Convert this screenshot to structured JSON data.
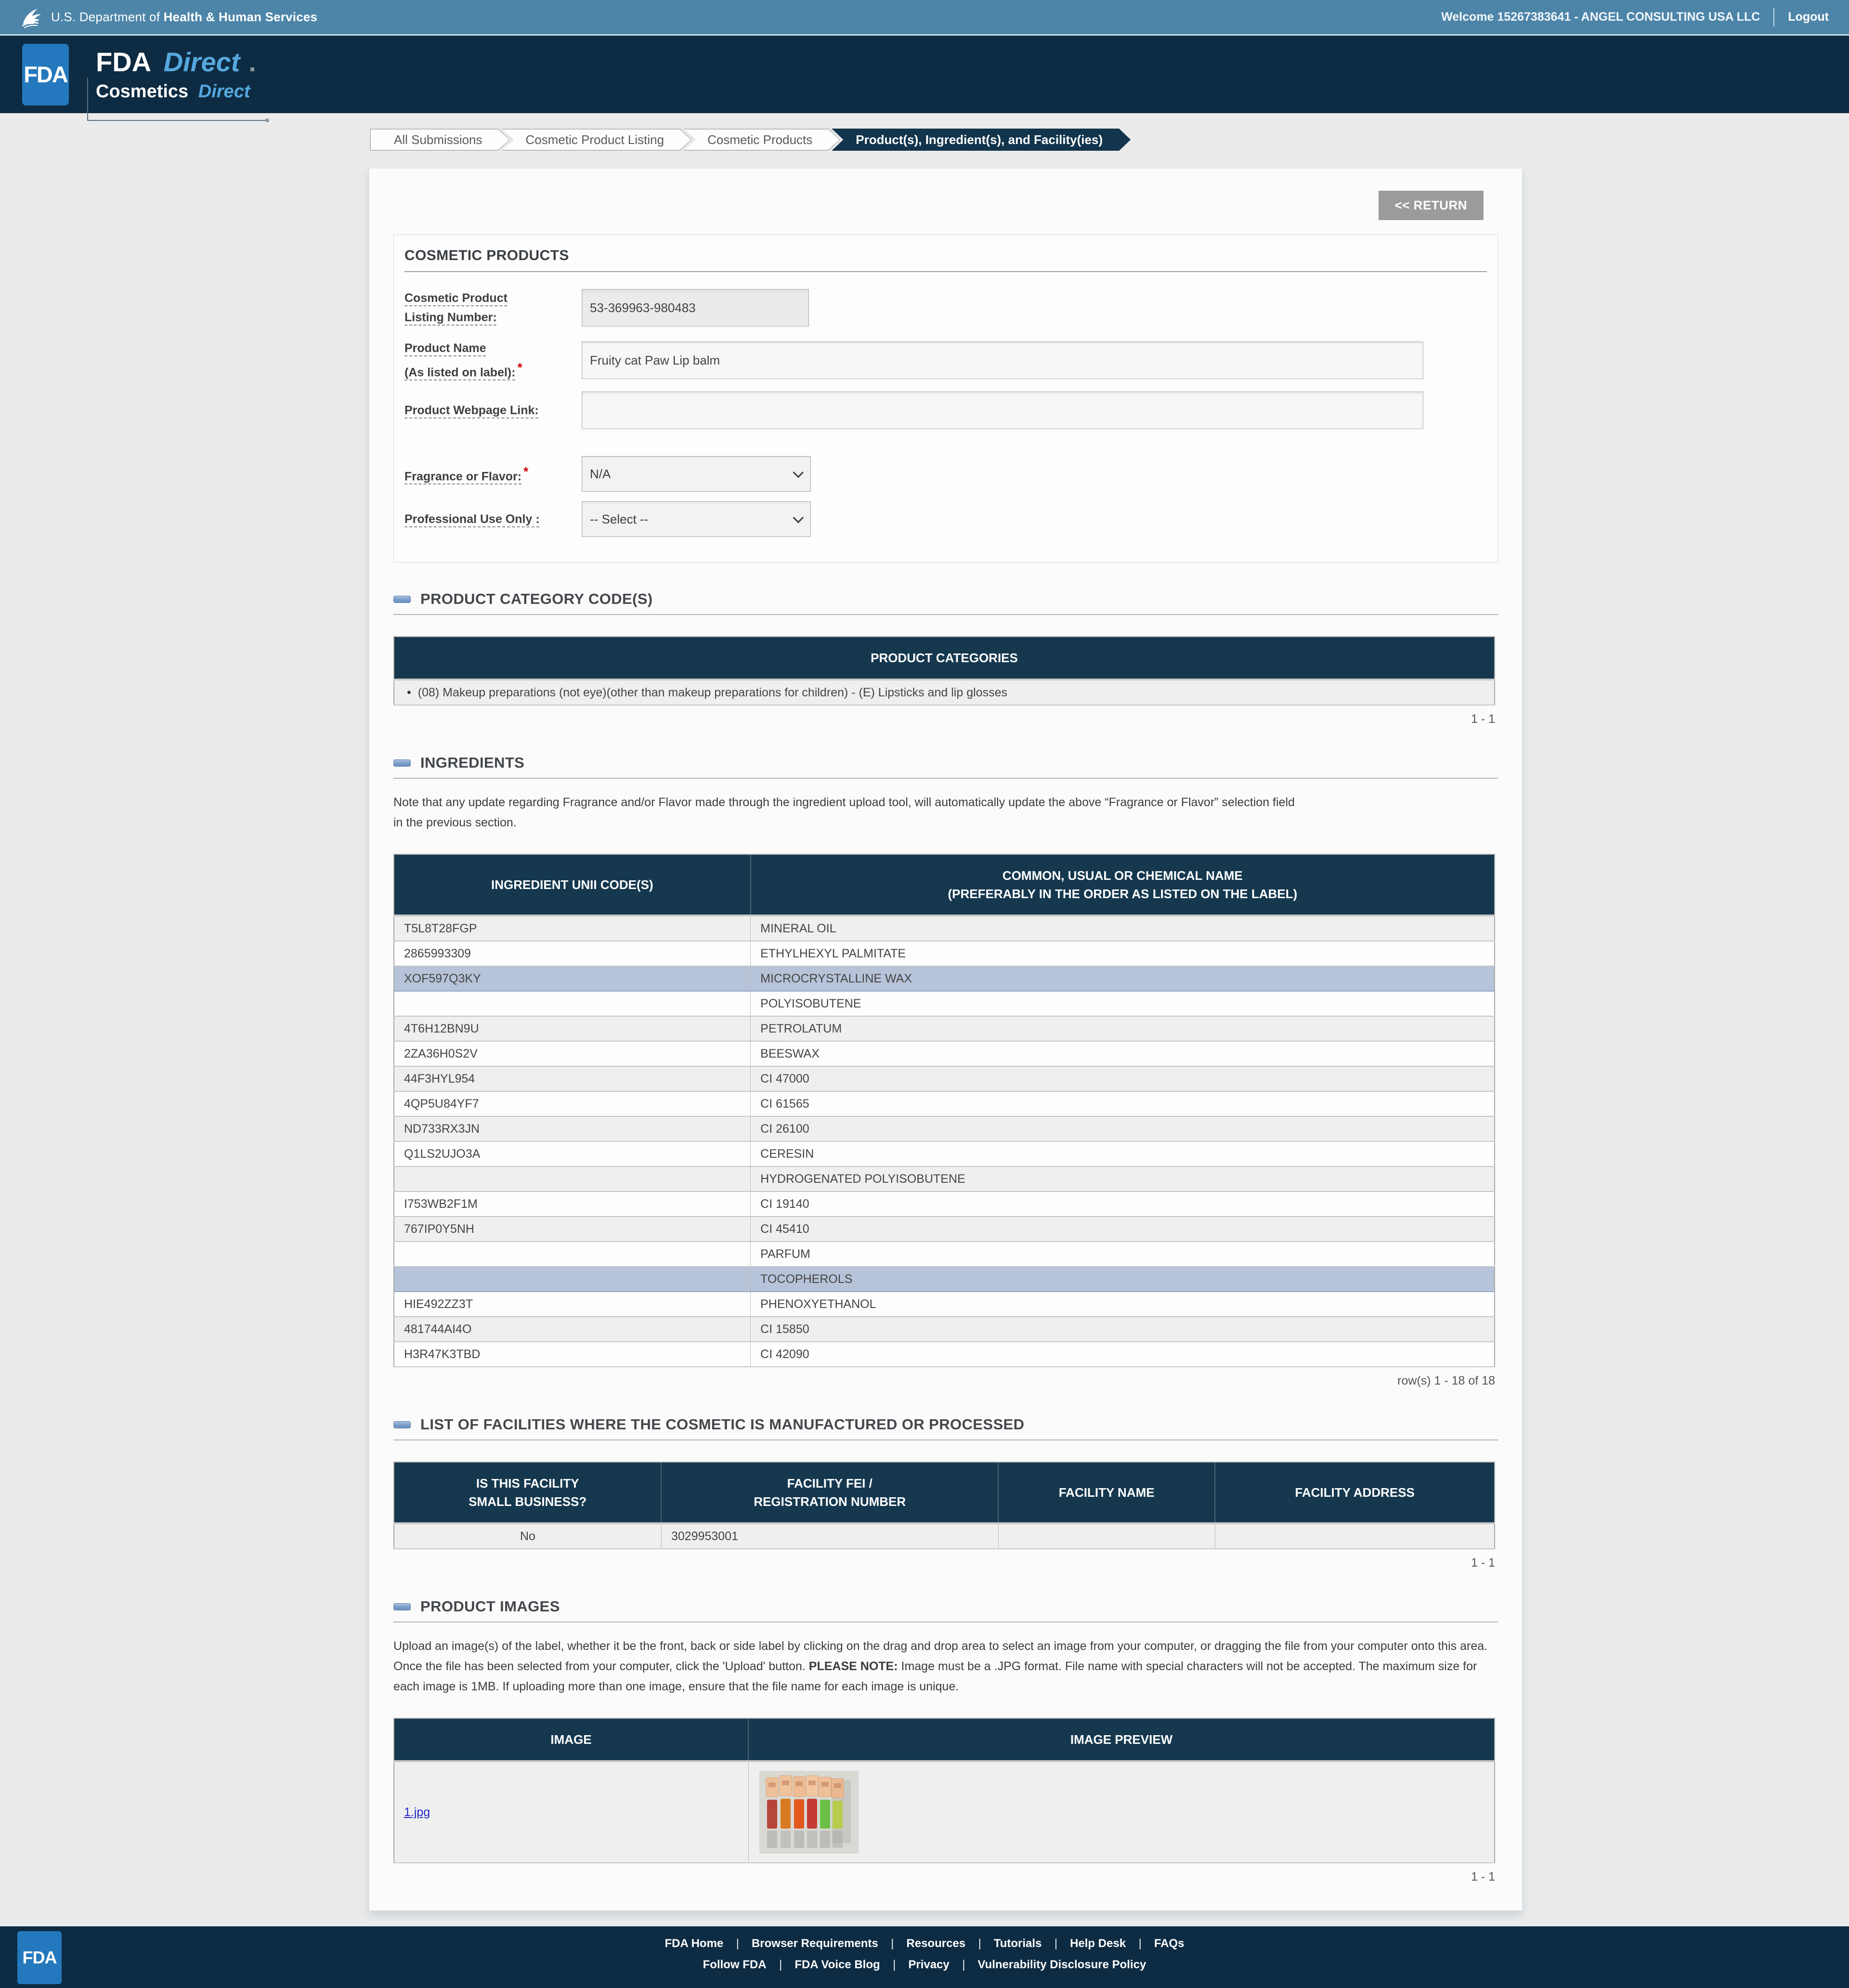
{
  "hhs_bar": {
    "dept_prefix": "U.S. Department of",
    "dept_bold": "Health & Human Services",
    "welcome_text": "Welcome 15267383641 - ANGEL CONSULTING USA LLC",
    "logout_label": "Logout"
  },
  "brand_header": {
    "fda_logo_text": "FDA",
    "title_bold": "FDA",
    "title_italic": "Direct",
    "subtitle_bold": "Cosmetics",
    "subtitle_italic": "Direct"
  },
  "breadcrumbs": [
    {
      "label": "All Submissions"
    },
    {
      "label": "Cosmetic Product Listing"
    },
    {
      "label": "Cosmetic Products"
    },
    {
      "label": "Product(s), Ingredient(s), and Facility(ies)"
    }
  ],
  "toolbar": {
    "return_label": "<< RETURN"
  },
  "required_marker": "*",
  "cosmetic_products": {
    "section_title": "COSMETIC PRODUCTS",
    "listing_number_label": "Cosmetic Product\nListing Number:",
    "listing_number_value": "53-369963-980483",
    "product_name_label": "Product Name\n(As listed on label):",
    "product_name_value": "Fruity cat Paw Lip balm",
    "webpage_label": "Product Webpage Link:",
    "webpage_value": "",
    "fragrance_label": "Fragrance or Flavor:",
    "fragrance_value": "N/A",
    "professional_label": "Professional Use Only :",
    "professional_value": "-- Select --"
  },
  "product_categories": {
    "section_title": "PRODUCT CATEGORY CODE(S)",
    "table_header": "PRODUCT CATEGORIES",
    "row_text": "(08) Makeup preparations (not eye)(other than makeup preparations for children) - (E) Lipsticks and lip glosses",
    "pagination": "1 - 1"
  },
  "ingredients": {
    "section_title": "INGREDIENTS",
    "note": "Note that any update regarding Fragrance and/or Flavor made through the ingredient upload tool, will automatically update the above “Fragrance or Flavor” selection field\nin the previous section.",
    "col_code": "INGREDIENT UNII CODE(S)",
    "col_name": "COMMON, USUAL OR CHEMICAL NAME\n(PREFERABLY IN THE ORDER AS LISTED ON THE LABEL)",
    "rows": [
      {
        "code": "T5L8T28FGP",
        "name": "MINERAL OIL"
      },
      {
        "code": "2865993309",
        "name": "ETHYLHEXYL PALMITATE"
      },
      {
        "code": "XOF597Q3KY",
        "name": "MICROCRYSTALLINE WAX"
      },
      {
        "code": "",
        "name": "POLYISOBUTENE"
      },
      {
        "code": "4T6H12BN9U",
        "name": "PETROLATUM"
      },
      {
        "code": "2ZA36H0S2V",
        "name": "BEESWAX"
      },
      {
        "code": "44F3HYL954",
        "name": "CI 47000"
      },
      {
        "code": "4QP5U84YF7",
        "name": "CI 61565"
      },
      {
        "code": "ND733RX3JN",
        "name": "CI 26100"
      },
      {
        "code": "Q1LS2UJO3A",
        "name": "CERESIN"
      },
      {
        "code": "",
        "name": "HYDROGENATED POLYISOBUTENE"
      },
      {
        "code": "I753WB2F1M",
        "name": "CI 19140"
      },
      {
        "code": "767IP0Y5NH",
        "name": "CI 45410"
      },
      {
        "code": "",
        "name": "PARFUM"
      },
      {
        "code": "",
        "name": "TOCOPHEROLS"
      },
      {
        "code": "HIE492ZZ3T",
        "name": "PHENOXYETHANOL"
      },
      {
        "code": "481744AI4O",
        "name": "CI 15850"
      },
      {
        "code": "H3R47K3TBD",
        "name": "CI 42090"
      }
    ],
    "pagination": "row(s) 1 - 18 of 18"
  },
  "facilities": {
    "section_title": "LIST OF FACILITIES WHERE THE COSMETIC IS MANUFACTURED OR PROCESSED",
    "col_small_business": "IS THIS FACILITY\nSMALL BUSINESS?",
    "col_fei": "FACILITY FEI /\nREGISTRATION NUMBER",
    "col_name": "FACILITY NAME",
    "col_address": "FACILITY ADDRESS",
    "row": {
      "small_business": "No",
      "fei": "3029953001",
      "name": "",
      "address": ""
    },
    "pagination": "1 - 1"
  },
  "product_images": {
    "section_title": "PRODUCT IMAGES",
    "note_before": "Upload an image(s) of the label, whether it be the front, back or side label by clicking on the drag and drop area to select an image from your computer, or dragging the file from your computer onto this area. Once the file has been selected from your computer, click the 'Upload' button. ",
    "note_bold": "PLEASE NOTE:",
    "note_after": " Image must be a .JPG format. File name with special characters will not be accepted. The maximum size for each image is 1MB. If uploading more than one image, ensure that the file name for each image is unique.",
    "col_image": "IMAGE",
    "col_preview": "IMAGE PREVIEW",
    "row": {
      "file_name": "1.jpg"
    },
    "pagination": "1 - 1"
  },
  "footer": {
    "fda_logo_text": "FDA",
    "links_row1": [
      "FDA Home",
      "Browser Requirements",
      "Resources",
      "Tutorials",
      "Help Desk",
      "FAQs"
    ],
    "links_row2": [
      "Follow FDA",
      "FDA Voice Blog",
      "Privacy",
      "Vulnerability Disclosure Policy"
    ]
  },
  "colors": {
    "navy": "#0d2b42",
    "table_header_navy": "#15384f",
    "hhs_blue": "#4d85a9",
    "fda_blue": "#2478bd",
    "accent_italic_blue": "#56a8de",
    "selected_row_blue": "#b7c3d9",
    "link_blue": "#2323cc",
    "required_red": "#cc0000"
  }
}
